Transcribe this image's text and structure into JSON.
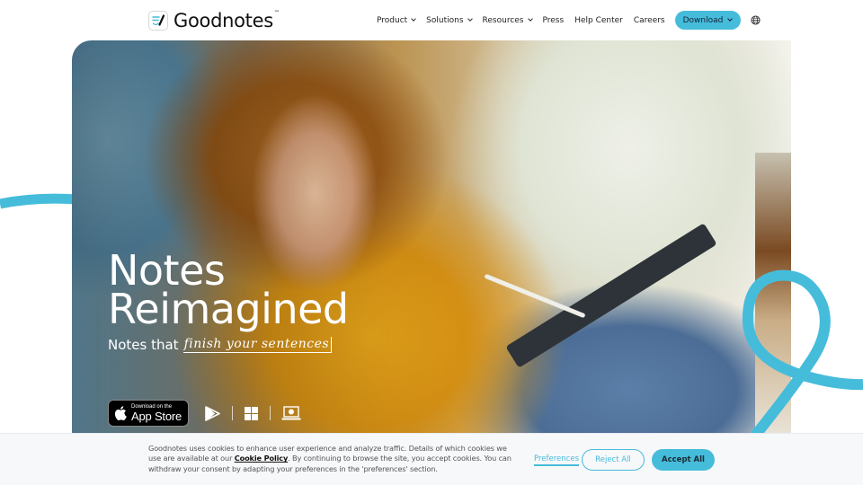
{
  "brand": {
    "name": "Goodnotes",
    "trademark": "™",
    "accent_color": "#46bcdb"
  },
  "nav": {
    "items": [
      {
        "label": "Product",
        "has_dropdown": true
      },
      {
        "label": "Solutions",
        "has_dropdown": true
      },
      {
        "label": "Resources",
        "has_dropdown": true
      },
      {
        "label": "Press",
        "has_dropdown": false
      },
      {
        "label": "Help Center",
        "has_dropdown": false
      },
      {
        "label": "Careers",
        "has_dropdown": false
      }
    ],
    "download_label": "Download",
    "language_icon": "globe-icon"
  },
  "hero": {
    "title_line1": "Notes",
    "title_line2": "Reimagined",
    "subtitle_prefix": "Notes that",
    "subtitle_script": "finish your sentences",
    "app_store": {
      "small": "Download on the",
      "big": "App Store"
    },
    "platform_icons": [
      "google-play-icon",
      "windows-icon",
      "web-laptop-icon"
    ]
  },
  "cookie_banner": {
    "text_part1": "Goodnotes uses cookies to enhance user experience and analyze traffic. Details of which cookies we use are available at our ",
    "link_label": "Cookie Policy",
    "text_part2": ". By continuing to browse the site, you accept cookies. You can withdraw your consent by adapting your preferences in the 'preferences' section.",
    "preferences_label": "Preferences",
    "reject_label": "Reject All",
    "accept_label": "Accept All"
  }
}
